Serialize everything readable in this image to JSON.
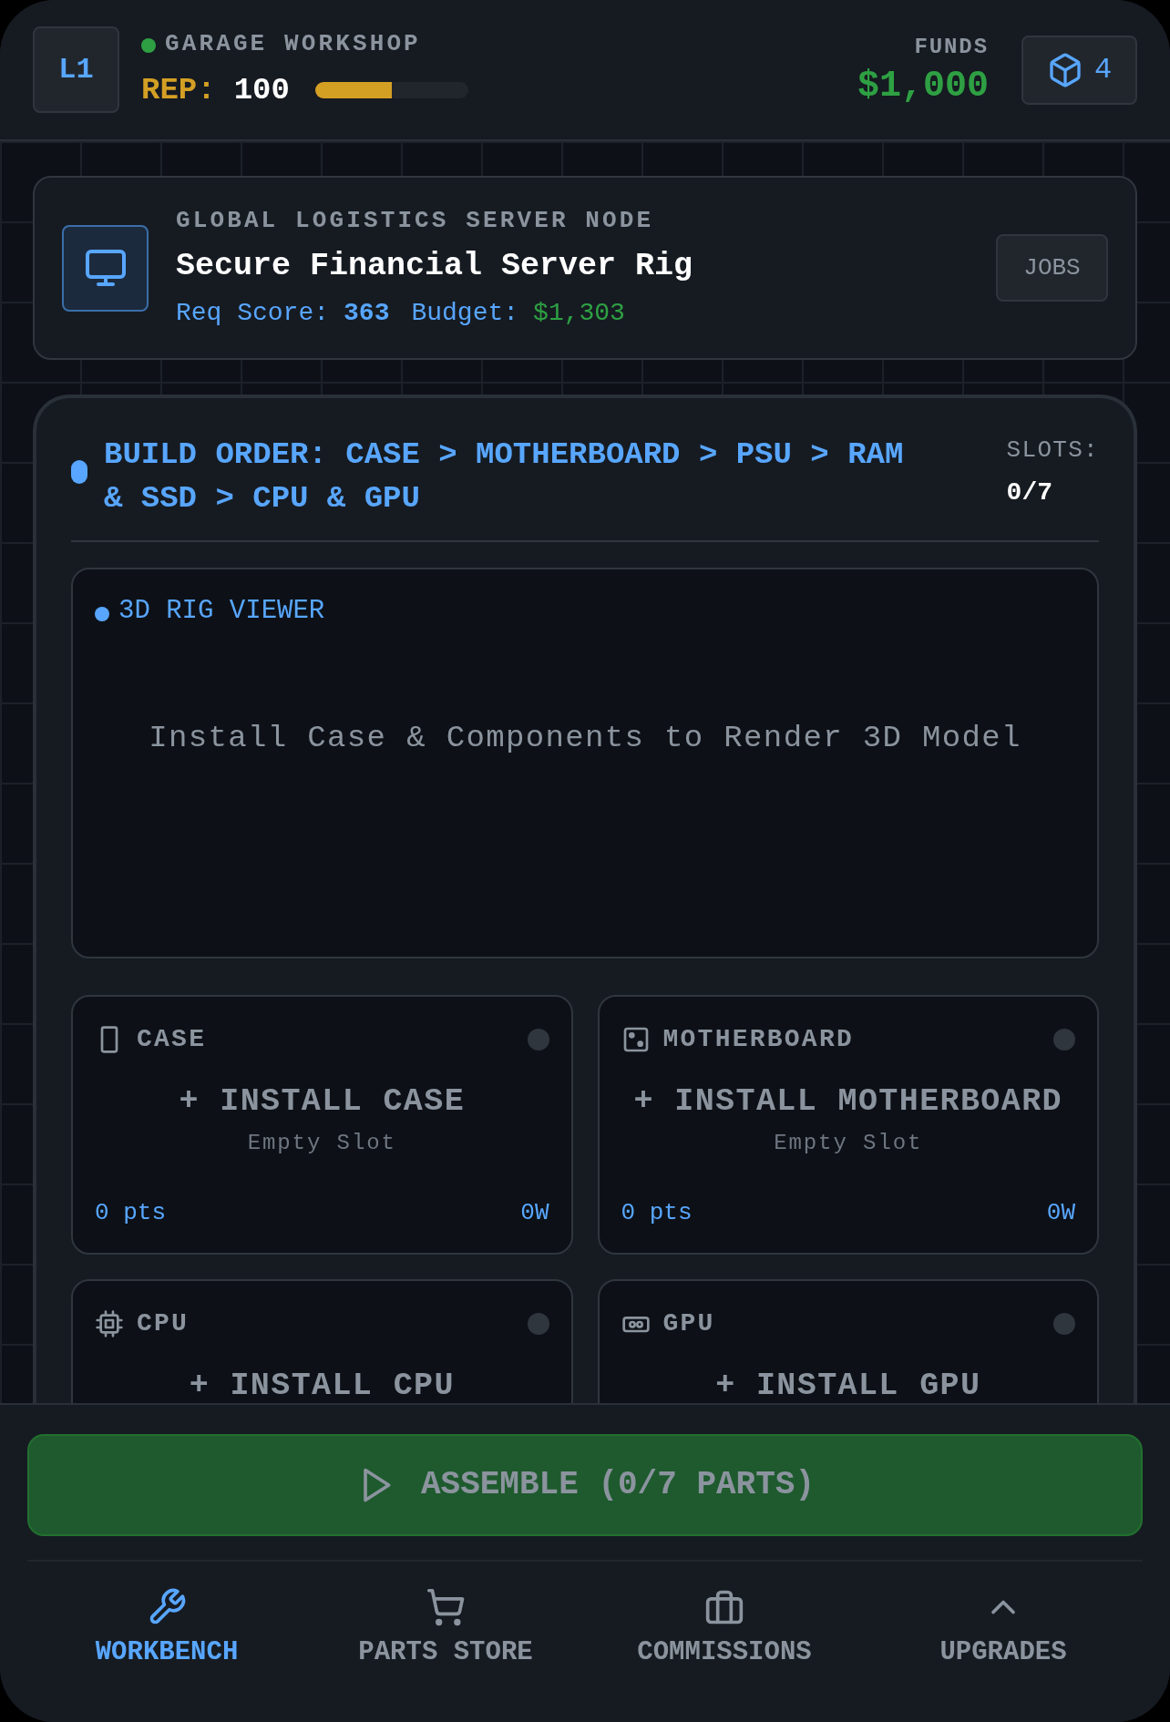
{
  "header": {
    "level_badge": "L1",
    "title": "GARAGE WORKSHOP",
    "rep_label": "REP:",
    "rep_value": "100",
    "rep_bar": {
      "level": 0.5
    },
    "funds_label": "FUNDS",
    "funds_value": "$1,000",
    "inventory_count": "4"
  },
  "job": {
    "client": "GLOBAL LOGISTICS SERVER NODE",
    "title": "Secure Financial Server Rig",
    "req_label": "Req Score:",
    "req_value": "363",
    "budget_label": "Budget:",
    "budget_value": "$1,303",
    "button": "JOBS"
  },
  "build": {
    "order": "BUILD ORDER: CASE > MOTHERBOARD > PSU > RAM & SSD > CPU & GPU",
    "slots_label": "SLOTS:",
    "slots_value": "0/7"
  },
  "viewer": {
    "title": "3D RIG VIEWER",
    "message": "Install Case & Components to Render 3D Model"
  },
  "slots": [
    {
      "kind": "case",
      "name": "CASE",
      "action": "+ INSTALL CASE",
      "status": "Empty Slot",
      "points": "0 pts",
      "power": "0W",
      "installed": false
    },
    {
      "kind": "motherboard",
      "name": "MOTHERBOARD",
      "action": "+ INSTALL MOTHERBOARD",
      "status": "Empty Slot",
      "points": "0 pts",
      "power": "0W",
      "installed": false
    },
    {
      "kind": "cpu",
      "name": "CPU",
      "action": "+ INSTALL CPU",
      "installed": false
    },
    {
      "kind": "gpu",
      "name": "GPU",
      "action": "+ INSTALL GPU",
      "installed": false
    }
  ],
  "assemble_button": {
    "label": "ASSEMBLE (0/7 PARTS)",
    "disabled": true
  },
  "nav": [
    {
      "kind": "wrench",
      "label": "WORKBENCH",
      "selected": true
    },
    {
      "kind": "cart",
      "label": "PARTS STORE",
      "selected": false
    },
    {
      "kind": "briefcase",
      "label": "COMMISSIONS",
      "selected": false
    },
    {
      "kind": "chevron",
      "label": "UPGRADES",
      "selected": false
    }
  ]
}
